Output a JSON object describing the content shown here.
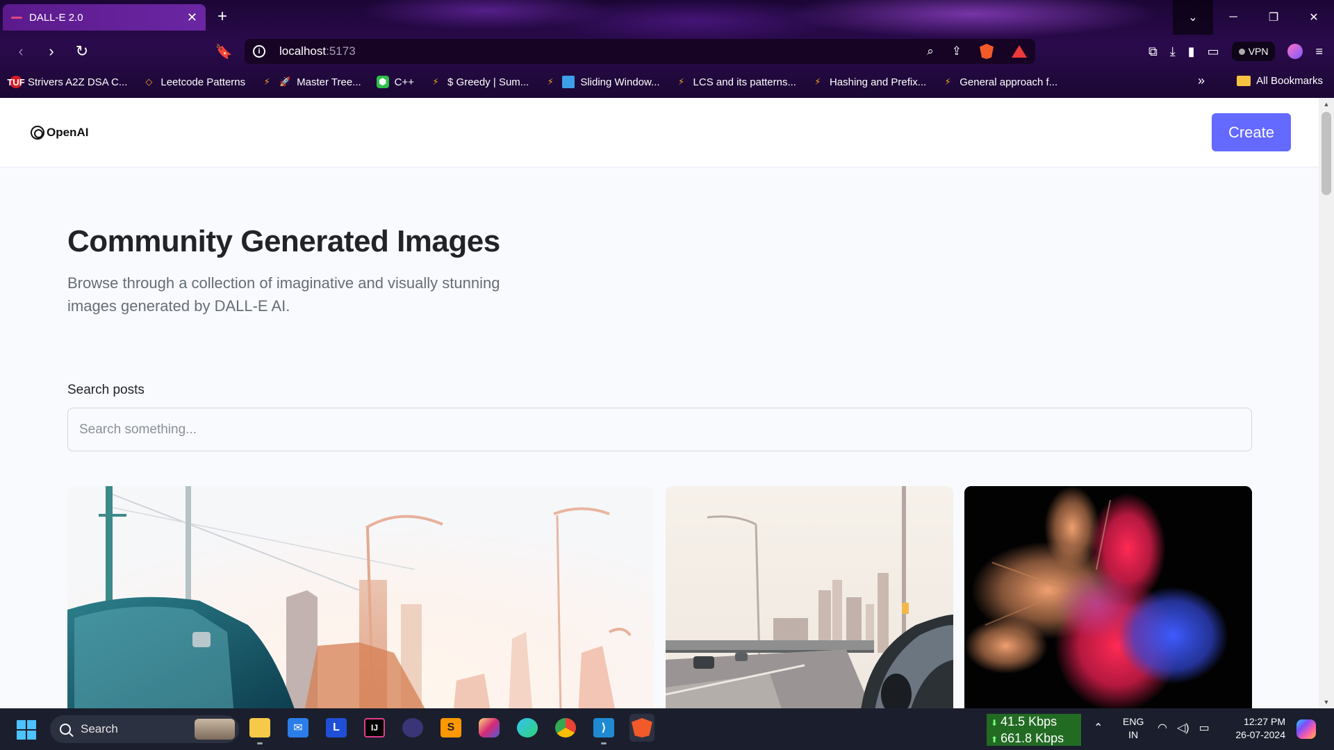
{
  "browser": {
    "tab_title": "DALL-E 2.0",
    "url_host": "localhost",
    "url_port": ":5173",
    "vpn_label": "VPN",
    "bookmarks": [
      "Strivers A2Z DSA C...",
      "Leetcode Patterns",
      "Master Tree...",
      "C++",
      "$ Greedy | Sum...",
      "Sliding Window...",
      "LCS and its patterns...",
      "Hashing and Prefix...",
      "General approach f..."
    ],
    "all_bookmarks": "All Bookmarks"
  },
  "header": {
    "logo_text": "OpenAI",
    "create_label": "Create"
  },
  "main": {
    "title": "Community Generated Images",
    "subtitle": "Browse through a collection of imaginative and visually stunning images generated by DALL-E AI.",
    "search_label": "Search posts",
    "search_placeholder": "Search something..."
  },
  "taskbar": {
    "search_label": "Search",
    "net_down": "41.5 Kbps",
    "net_up": "661.8 Kbps",
    "lang_top": "ENG",
    "lang_bottom": "IN",
    "time": "12:27 PM",
    "date": "26-07-2024"
  },
  "colors": {
    "accent": "#6469ff",
    "page_bg": "#f9fafe",
    "heading": "#222328",
    "subtitle": "#666e75"
  }
}
